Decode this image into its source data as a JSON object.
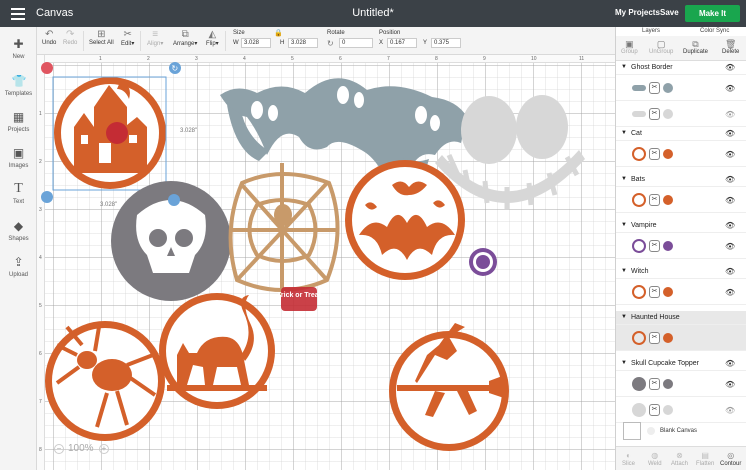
{
  "header": {
    "app_title": "Canvas",
    "doc_title": "Untitled*",
    "my_projects": "My Projects",
    "save": "Save",
    "make_it": "Make It"
  },
  "left_toolbar": {
    "items": [
      {
        "label": "New",
        "icon": "plus-icon"
      },
      {
        "label": "Templates",
        "icon": "shirt-icon"
      },
      {
        "label": "Projects",
        "icon": "projects-icon"
      },
      {
        "label": "Images",
        "icon": "image-icon"
      },
      {
        "label": "Text",
        "icon": "text-icon"
      },
      {
        "label": "Shapes",
        "icon": "shapes-icon"
      },
      {
        "label": "Upload",
        "icon": "upload-icon"
      }
    ]
  },
  "top_toolbar": {
    "undo": "Undo",
    "redo": "Redo",
    "select_all": "Select All",
    "edit": "Edit",
    "align": "Align",
    "arrange": "Arrange",
    "flip": "Flip",
    "size_label": "Size",
    "w_label": "W",
    "w_value": "3.028",
    "h_label": "H",
    "h_value": "3.028",
    "rotate_label": "Rotate",
    "rotate_value": "0",
    "position_label": "Position",
    "x_label": "X",
    "x_value": "0.167",
    "y_label": "Y",
    "y_value": "0.375"
  },
  "canvas": {
    "ruler_top": [
      "1",
      "2",
      "3",
      "4",
      "5",
      "6",
      "7",
      "8",
      "9",
      "10",
      "11"
    ],
    "ruler_left": [
      "1",
      "2",
      "3",
      "4",
      "5",
      "6",
      "7",
      "8"
    ],
    "dim_width": "3.028\"",
    "dim_height": "3.028\"",
    "sticker_text": "Trick or Treat",
    "zoom": "100%",
    "colors": {
      "orange": "#d4602a",
      "gray_skull": "#7c7a7f",
      "ghost": "#8fa1a9",
      "web": "#c89a6a",
      "jack": "#d7d7d7",
      "vampire": "#7b4d99",
      "red": "#c42c34"
    }
  },
  "panel": {
    "tab_layers": "Layers",
    "tab_color_sync": "Color Sync",
    "actions": [
      {
        "label": "Group",
        "icon": "group-icon",
        "enabled": false
      },
      {
        "label": "UnGroup",
        "icon": "ungroup-icon",
        "enabled": false
      },
      {
        "label": "Duplicate",
        "icon": "duplicate-icon",
        "enabled": true
      },
      {
        "label": "Delete",
        "icon": "delete-icon",
        "enabled": true
      }
    ],
    "groups": [
      {
        "name": "Ghost Border",
        "layers": [
          {
            "color": "#8fa1a9"
          },
          {
            "color": "#d7d7d7"
          }
        ]
      },
      {
        "name": "Cat",
        "layers": [
          {
            "color": "#d4602a"
          }
        ]
      },
      {
        "name": "Bats",
        "layers": [
          {
            "color": "#d4602a"
          }
        ]
      },
      {
        "name": "Vampire",
        "layers": [
          {
            "color": "#7b4d99"
          }
        ]
      },
      {
        "name": "Witch",
        "layers": [
          {
            "color": "#d4602a"
          }
        ]
      },
      {
        "name": "Haunted House",
        "layers": [
          {
            "color": "#d4602a"
          }
        ],
        "selected": true
      },
      {
        "name": "Skull Cupcake Topper",
        "layers": [
          {
            "color": "#7c7a7f"
          },
          {
            "color": "#d7d7d7"
          }
        ]
      }
    ],
    "blank_canvas": "Blank Canvas",
    "bottom_actions": [
      {
        "label": "Slice",
        "icon": "slice-icon"
      },
      {
        "label": "Weld",
        "icon": "weld-icon"
      },
      {
        "label": "Attach",
        "icon": "attach-icon"
      },
      {
        "label": "Flatten",
        "icon": "flatten-icon"
      },
      {
        "label": "Contour",
        "icon": "contour-icon"
      }
    ]
  }
}
